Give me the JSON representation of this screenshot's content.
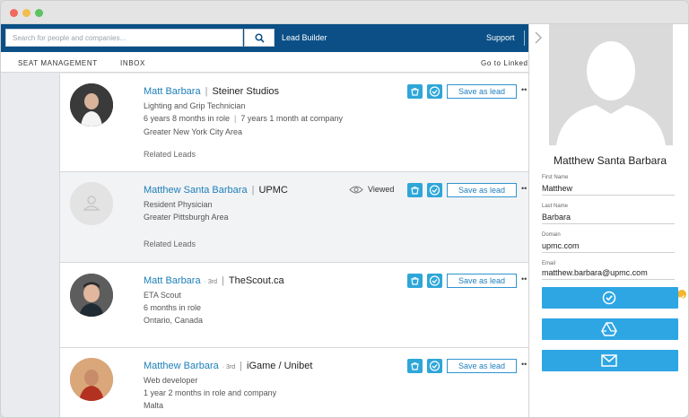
{
  "search": {
    "placeholder": "Search for people and companies..."
  },
  "topnav": {
    "lead_builder": "Lead Builder",
    "support": "Support"
  },
  "subnav": {
    "seat_management": "SEAT MANAGEMENT",
    "inbox": "INBOX",
    "goto": "Go to Linked"
  },
  "leads": [
    {
      "name": "Matt Barbara",
      "degree": "",
      "company": "Steiner Studios",
      "line1": "Lighting and Grip Technician",
      "line2a": "6 years 8 months in role",
      "line2b": "7 years 1 month at company",
      "line3": "Greater New York City Area",
      "related": "Related Leads",
      "save": "Save as lead"
    },
    {
      "name": "Matthew Santa Barbara",
      "degree": "",
      "company": "UPMC",
      "line1": "Resident Physician",
      "line2a": "Greater Pittsburgh Area",
      "line2b": "",
      "line3": "",
      "related": "Related Leads",
      "viewed": "Viewed",
      "save": "Save as lead"
    },
    {
      "name": "Matt Barbara",
      "degree": "3rd",
      "company": "TheScout.ca",
      "line1": "ETA Scout",
      "line2a": "6 months in role",
      "line2b": "",
      "line3": "Ontario, Canada",
      "related": "",
      "save": "Save as lead"
    },
    {
      "name": "Matthew Barbara",
      "degree": "3rd",
      "company": "iGame / Unibet",
      "line1": "Web developer",
      "line2a": "1 year 2 months in role and company",
      "line2b": "",
      "line3": "Malta",
      "related": "",
      "save": "Save as lead"
    }
  ],
  "panel": {
    "full_name": "Matthew Santa Barbara",
    "first_name_label": "First Name",
    "first_name": "Matthew",
    "last_name_label": "Last Name",
    "last_name": "Barbara",
    "domain_label": "Domain",
    "domain": "upmc.com",
    "email_label": "Email",
    "email": "matthew.barbara@upmc.com"
  },
  "colors": {
    "brand": "#0b4f86",
    "accent": "#2ea6e4",
    "link": "#1d7fb8",
    "badge": "#f2b632"
  }
}
